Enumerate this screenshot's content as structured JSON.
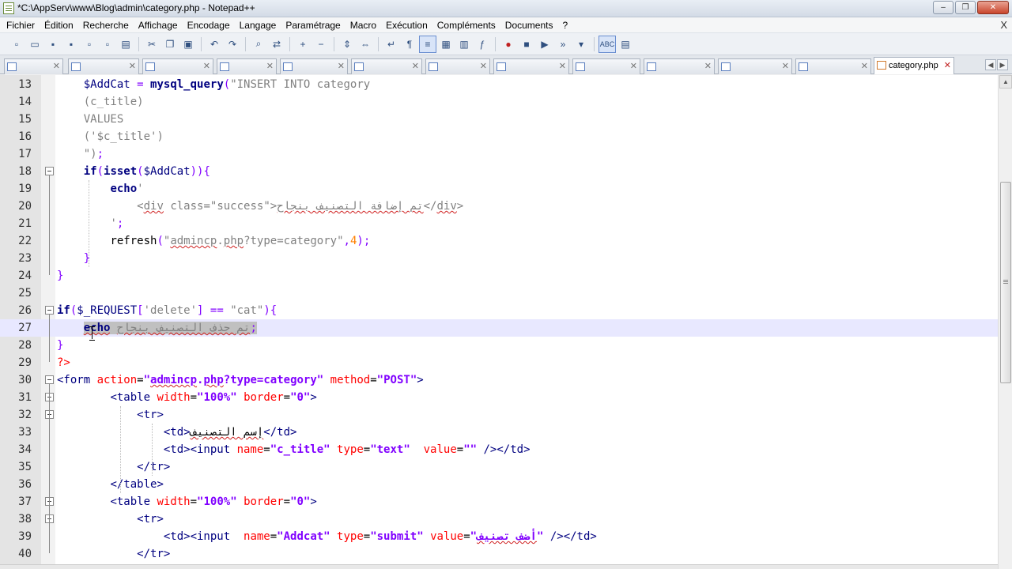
{
  "window": {
    "title": "*C:\\AppServ\\www\\Blog\\admin\\category.php - Notepad++",
    "buttons": [
      "–",
      "❐",
      "✕"
    ]
  },
  "menu": {
    "items": [
      "Fichier",
      "Édition",
      "Recherche",
      "Affichage",
      "Encodage",
      "Langage",
      "Paramétrage",
      "Macro",
      "Exécution",
      "Compléments",
      "Documents",
      "?"
    ],
    "close": "X"
  },
  "toolbar": {
    "icons": [
      "new-file-icon",
      "open-file-icon",
      "save-icon",
      "save-all-icon",
      "close-icon",
      "close-all-icon",
      "print-icon",
      "cut-icon",
      "copy-icon",
      "paste-icon",
      "undo-icon",
      "redo-icon",
      "find-icon",
      "replace-icon",
      "zoom-in-icon",
      "zoom-out-icon",
      "sync-vertical-icon",
      "sync-horizontal-icon",
      "word-wrap-icon",
      "show-all-chars-icon",
      "indent-guide-icon",
      "udl-icon",
      "doc-map-icon",
      "function-list-icon",
      "record-macro-icon",
      "stop-macro-icon",
      "play-macro-icon",
      "run-macro-multiple-icon",
      "save-macro-icon",
      "spellcheck-icon",
      "launch-icon"
    ]
  },
  "tabs": {
    "active_label": "category.php",
    "close_glyph": "✕",
    "nav_left": "◀",
    "nav_right": "▶"
  },
  "editor": {
    "lines": [
      {
        "n": "13",
        "t": [
          [
            "    ",
            ""
          ],
          [
            "$AddCat",
            "var"
          ],
          [
            " = ",
            "op"
          ],
          [
            "mysql_query",
            "fn"
          ],
          [
            "(",
            "op"
          ],
          [
            "\"INSERT INTO category",
            "str"
          ]
        ]
      },
      {
        "n": "14",
        "t": [
          [
            "    ",
            ""
          ],
          [
            "(c_title)",
            "str"
          ]
        ]
      },
      {
        "n": "15",
        "t": [
          [
            "    ",
            ""
          ],
          [
            "VALUES",
            "str"
          ]
        ]
      },
      {
        "n": "16",
        "t": [
          [
            "    ",
            ""
          ],
          [
            "('",
            "str"
          ],
          [
            "$c_title",
            "str"
          ],
          [
            "')",
            "str"
          ]
        ]
      },
      {
        "n": "17",
        "t": [
          [
            "    ",
            ""
          ],
          [
            "\")",
            "str"
          ],
          [
            ";",
            "op"
          ]
        ]
      },
      {
        "n": "18",
        "t": [
          [
            "    ",
            ""
          ],
          [
            "if",
            "kw"
          ],
          [
            "(",
            "op"
          ],
          [
            "isset",
            "fn"
          ],
          [
            "(",
            "op"
          ],
          [
            "$AddCat",
            "var"
          ],
          [
            "))",
            "op"
          ],
          [
            "{",
            "op"
          ]
        ]
      },
      {
        "n": "19",
        "t": [
          [
            "        ",
            ""
          ],
          [
            "echo",
            "kw"
          ],
          [
            "'",
            "str"
          ]
        ]
      },
      {
        "n": "20",
        "t": [
          [
            "            ",
            ""
          ],
          [
            "<",
            "str"
          ],
          [
            "div",
            "str squig"
          ],
          [
            " class=\"success\">",
            "str"
          ],
          [
            "تم إضافة التصنيف بنجاح",
            "str squig"
          ],
          [
            "</",
            "str"
          ],
          [
            "div",
            "str squig"
          ],
          [
            ">",
            "str"
          ]
        ]
      },
      {
        "n": "21",
        "t": [
          [
            "        ",
            ""
          ],
          [
            "'",
            "str"
          ],
          [
            ";",
            "op"
          ]
        ]
      },
      {
        "n": "22",
        "t": [
          [
            "        ",
            ""
          ],
          [
            "refresh",
            "pl"
          ],
          [
            "(",
            "op"
          ],
          [
            "\"",
            "str"
          ],
          [
            "admincp",
            "str squig"
          ],
          [
            ".",
            "str"
          ],
          [
            "php",
            "str squig"
          ],
          [
            "?type=category\"",
            "str"
          ],
          [
            ",",
            "op"
          ],
          [
            "4",
            "num"
          ],
          [
            ")",
            "op"
          ],
          [
            ";",
            "op"
          ]
        ]
      },
      {
        "n": "23",
        "t": [
          [
            "    ",
            ""
          ],
          [
            "}",
            "op"
          ]
        ]
      },
      {
        "n": "24",
        "t": [
          [
            "",
            ""
          ],
          [
            "}",
            "op"
          ]
        ]
      },
      {
        "n": "25",
        "t": [
          [
            "",
            ""
          ]
        ]
      },
      {
        "n": "26",
        "t": [
          [
            "",
            ""
          ],
          [
            "if",
            "kw"
          ],
          [
            "(",
            "op"
          ],
          [
            "$_REQUEST",
            "var"
          ],
          [
            "[",
            "op"
          ],
          [
            "'delete'",
            "str"
          ],
          [
            "]",
            "op"
          ],
          [
            " == ",
            "op"
          ],
          [
            "\"cat\"",
            "str"
          ],
          [
            ")",
            "op"
          ],
          [
            "{",
            "op"
          ]
        ]
      },
      {
        "n": "27",
        "t": [
          [
            "    ",
            ""
          ],
          [
            "echo",
            "kw sel squig"
          ],
          [
            " ",
            "sel"
          ],
          [
            "تم حذف التصنيف بنجاح",
            "str sel squig"
          ],
          [
            ";",
            "op sel"
          ]
        ]
      },
      {
        "n": "28",
        "t": [
          [
            "",
            ""
          ],
          [
            "}",
            "op"
          ]
        ]
      },
      {
        "n": "29",
        "t": [
          [
            "",
            ""
          ],
          [
            "?>",
            "php"
          ]
        ]
      },
      {
        "n": "30",
        "t": [
          [
            "",
            ""
          ],
          [
            "<form ",
            "tag"
          ],
          [
            "action",
            "attr"
          ],
          [
            "=",
            "pl"
          ],
          [
            "\"",
            "aval"
          ],
          [
            "admincp",
            "aval squig"
          ],
          [
            ".",
            "aval"
          ],
          [
            "php",
            "aval squig"
          ],
          [
            "?type=category\"",
            "aval"
          ],
          [
            " ",
            "pl"
          ],
          [
            "method",
            "attr"
          ],
          [
            "=",
            "pl"
          ],
          [
            "\"POST\"",
            "aval"
          ],
          [
            ">",
            "tag"
          ]
        ]
      },
      {
        "n": "31",
        "t": [
          [
            "        ",
            ""
          ],
          [
            "<table ",
            "tag"
          ],
          [
            "width",
            "attr"
          ],
          [
            "=",
            "pl"
          ],
          [
            "\"100%\"",
            "aval"
          ],
          [
            " ",
            "pl"
          ],
          [
            "border",
            "attr"
          ],
          [
            "=",
            "pl"
          ],
          [
            "\"0\"",
            "aval"
          ],
          [
            ">",
            "tag"
          ]
        ]
      },
      {
        "n": "32",
        "t": [
          [
            "            ",
            ""
          ],
          [
            "<tr>",
            "tag"
          ]
        ]
      },
      {
        "n": "33",
        "t": [
          [
            "                ",
            ""
          ],
          [
            "<td>",
            "tag"
          ],
          [
            "إسم التصنيف",
            "pl squig"
          ],
          [
            "</td>",
            "tag"
          ]
        ]
      },
      {
        "n": "34",
        "t": [
          [
            "                ",
            ""
          ],
          [
            "<td><input ",
            "tag"
          ],
          [
            "name",
            "attr"
          ],
          [
            "=",
            "pl"
          ],
          [
            "\"c_title\"",
            "aval"
          ],
          [
            " ",
            "pl"
          ],
          [
            "type",
            "attr"
          ],
          [
            "=",
            "pl"
          ],
          [
            "\"text\"",
            "aval"
          ],
          [
            "  ",
            "pl"
          ],
          [
            "value",
            "attr"
          ],
          [
            "=",
            "pl"
          ],
          [
            "\"\"",
            "aval"
          ],
          [
            " /></td>",
            "tag"
          ]
        ]
      },
      {
        "n": "35",
        "t": [
          [
            "            ",
            ""
          ],
          [
            "</tr>",
            "tag"
          ]
        ]
      },
      {
        "n": "36",
        "t": [
          [
            "        ",
            ""
          ],
          [
            "</table>",
            "tag"
          ]
        ]
      },
      {
        "n": "37",
        "t": [
          [
            "        ",
            ""
          ],
          [
            "<table ",
            "tag"
          ],
          [
            "width",
            "attr"
          ],
          [
            "=",
            "pl"
          ],
          [
            "\"100%\"",
            "aval"
          ],
          [
            " ",
            "pl"
          ],
          [
            "border",
            "attr"
          ],
          [
            "=",
            "pl"
          ],
          [
            "\"0\"",
            "aval"
          ],
          [
            ">",
            "tag"
          ]
        ]
      },
      {
        "n": "38",
        "t": [
          [
            "            ",
            ""
          ],
          [
            "<tr>",
            "tag"
          ]
        ]
      },
      {
        "n": "39",
        "t": [
          [
            "                ",
            ""
          ],
          [
            "<td><input  ",
            "tag"
          ],
          [
            "name",
            "attr"
          ],
          [
            "=",
            "pl"
          ],
          [
            "\"Addcat\"",
            "aval"
          ],
          [
            " ",
            "pl"
          ],
          [
            "type",
            "attr"
          ],
          [
            "=",
            "pl"
          ],
          [
            "\"submit\"",
            "aval"
          ],
          [
            " ",
            "pl"
          ],
          [
            "value",
            "attr"
          ],
          [
            "=",
            "pl"
          ],
          [
            "\"",
            "aval"
          ],
          [
            "أضف تصنيف",
            "aval squig"
          ],
          [
            "\"",
            "aval"
          ],
          [
            " /></td>",
            "tag"
          ]
        ]
      },
      {
        "n": "40",
        "t": [
          [
            "            ",
            ""
          ],
          [
            "</tr>",
            "tag"
          ]
        ]
      }
    ]
  },
  "colors": {
    "keyword": "#000080",
    "string": "#808080",
    "number": "#ff8000",
    "operator": "#8000ff",
    "attribute": "#ff0000",
    "current_line": "#e8e8ff"
  }
}
